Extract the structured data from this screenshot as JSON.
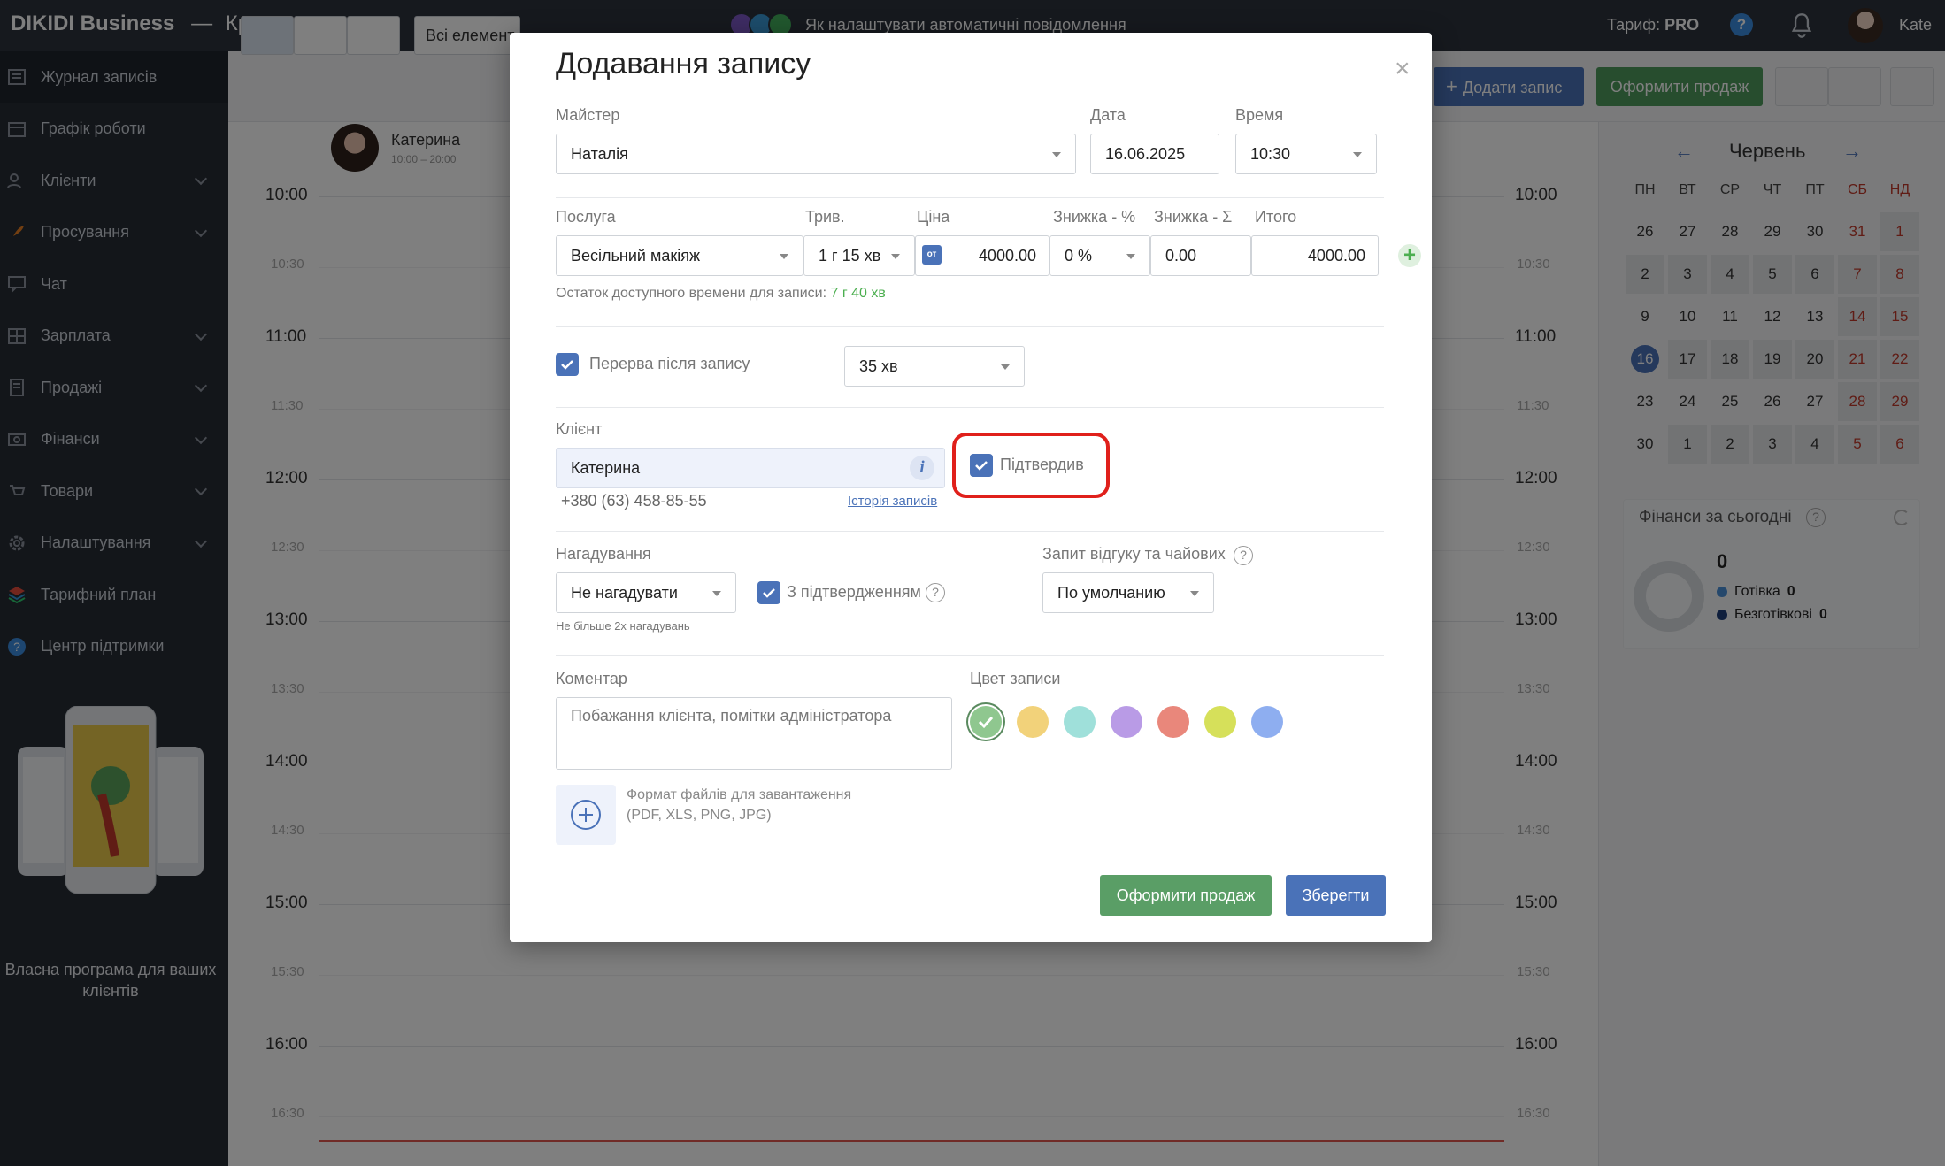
{
  "topbar": {
    "brand": "DIKIDI Business",
    "separator": "—",
    "company": "Краса",
    "banner_text": "Як налаштувати автоматичні повідомлення",
    "tariff_label": "Тариф:",
    "tariff_value": "PRO",
    "help_label": "?",
    "user_name": "Kate"
  },
  "sidebar": {
    "items": [
      {
        "label": "Журнал записів",
        "icon": "journal-icon",
        "chevron": false
      },
      {
        "label": "Графік роботи",
        "icon": "calendar-icon",
        "chevron": false
      },
      {
        "label": "Клієнти",
        "icon": "clients-icon",
        "chevron": true
      },
      {
        "label": "Просування",
        "icon": "rocket-icon",
        "chevron": true
      },
      {
        "label": "Чат",
        "icon": "chat-icon",
        "chevron": false
      },
      {
        "label": "Зарплата",
        "icon": "salary-icon",
        "chevron": true
      },
      {
        "label": "Продажі",
        "icon": "sales-icon",
        "chevron": true
      },
      {
        "label": "Фінанси",
        "icon": "finance-icon",
        "chevron": true
      },
      {
        "label": "Товари",
        "icon": "goods-icon",
        "chevron": true
      },
      {
        "label": "Налаштування",
        "icon": "gear-icon",
        "chevron": true
      },
      {
        "label": "Тарифний план",
        "icon": "layers-icon",
        "chevron": false
      },
      {
        "label": "Центр підтримки",
        "icon": "help-icon",
        "chevron": false
      }
    ],
    "promo_text": "Власна програма для ваших клієнтів"
  },
  "toolbar": {
    "all_elements": "Всі елемент",
    "add_record": "Додати запис",
    "make_sale": "Оформити продаж"
  },
  "calendar": {
    "master_name": "Катерина",
    "master_hours": "10:00 – 20:00",
    "times": [
      "10:00",
      "10:30",
      "11:00",
      "11:30",
      "12:00",
      "12:30",
      "13:00",
      "13:30",
      "14:00",
      "14:30",
      "15:00",
      "15:30",
      "16:00",
      "16:30"
    ]
  },
  "mini_calendar": {
    "month": "Червень",
    "prev": "←",
    "next": "→",
    "weekdays": [
      "ПН",
      "ВТ",
      "СР",
      "ЧТ",
      "ПТ",
      "СБ",
      "НД"
    ],
    "weeks": [
      [
        "26",
        "27",
        "28",
        "29",
        "30",
        "31",
        "1"
      ],
      [
        "2",
        "3",
        "4",
        "5",
        "6",
        "7",
        "8"
      ],
      [
        "9",
        "10",
        "11",
        "12",
        "13",
        "14",
        "15"
      ],
      [
        "16",
        "17",
        "18",
        "19",
        "20",
        "21",
        "22"
      ],
      [
        "23",
        "24",
        "25",
        "26",
        "27",
        "28",
        "29"
      ],
      [
        "30",
        "1",
        "2",
        "3",
        "4",
        "5",
        "6"
      ]
    ],
    "today": "16"
  },
  "finance": {
    "title": "Фінанси за сьогодні",
    "help": "?",
    "total": "0",
    "cash_label": "Готівка",
    "cash_value": "0",
    "noncash_label": "Безготівкові",
    "noncash_value": "0",
    "cash_color": "#4a90d9",
    "noncash_color": "#1f3f7a"
  },
  "modal": {
    "title": "Додавання запису",
    "close": "×",
    "master_label": "Майстер",
    "master_value": "Наталія",
    "date_label": "Дата",
    "date_value": "16.06.2025",
    "time_label": "Время",
    "time_value": "10:30",
    "service_label": "Послуга",
    "service_value": "Весільний макіяж",
    "duration_label": "Трив.",
    "duration_value": "1 г 15 хв",
    "price_label": "Ціна",
    "price_prefix": "от",
    "price_value": "4000.00",
    "discount_pct_label": "Знижка - %",
    "discount_pct_value": "0 %",
    "discount_sum_label": "Знижка - Σ",
    "discount_sum_value": "0.00",
    "total_label": "Итого",
    "total_value": "4000.00",
    "add_service": "+",
    "remaining_text": "Остаток доступного времени для записи:",
    "remaining_value": "7 г 40 хв",
    "break_label": "Перерва після запису",
    "break_value": "35 хв",
    "client_label": "Клієнт",
    "client_value": "Катерина",
    "client_info": "i",
    "confirmed_label": "Підтвердив",
    "client_phone": "+380 (63) 458-85-55",
    "history_link": "Історія записів",
    "reminder_label": "Нагадування",
    "reminder_value": "Не нагадувати",
    "with_confirm_label": "З підтвердженням",
    "reminder_note": "Не більше 2х нагадувань",
    "feedback_label": "Запит відгуку та чайових",
    "feedback_value": "По умолчанию",
    "help": "?",
    "comment_label": "Коментар",
    "comment_placeholder": "Побажання клієнта, помітки адміністратора",
    "color_label": "Цвет записи",
    "colors": [
      "#8fc78f",
      "#f2d27a",
      "#9fe0da",
      "#b99be6",
      "#e9877b",
      "#d6e05a",
      "#8eaef0"
    ],
    "upload_text": "Формат файлів для завантаження (PDF, XLS, PNG, JPG)",
    "sale_button": "Оформити продаж",
    "save_button": "Зберегти"
  }
}
